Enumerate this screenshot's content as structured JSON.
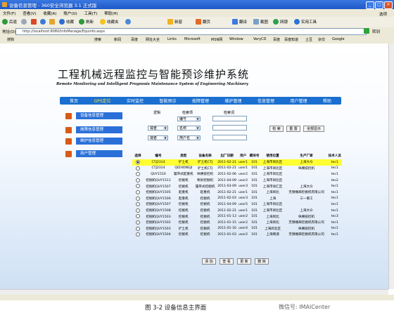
{
  "window": {
    "title": "设备信息管理 - 360安全浏览器 3.1 正式版"
  },
  "menu": {
    "items": [
      "文件(F)",
      "查看(V)",
      "收藏(A)",
      "账户(U)",
      "工具(T)",
      "帮助(H)"
    ],
    "right_label": "选项"
  },
  "toolbar": {
    "items": [
      "后退",
      "",
      "",
      "",
      "",
      "收藏",
      "刷新",
      "收藏夹",
      "",
      "新窗",
      "翻页",
      "翻译",
      "截图",
      "网银",
      "实用工具"
    ]
  },
  "address": {
    "label": "地址(D)",
    "url": "http://localhost:8080/InfoManage/Equinfo.aspx",
    "go_label": "转到"
  },
  "favorites": {
    "items": [
      "搜狗",
      "搜索",
      "新闻",
      "百度",
      "网址大全",
      "Links",
      "Microsoft",
      "MSN网",
      "Window",
      "VeryCD",
      "百度",
      "百度知道",
      "土豆",
      "杂交",
      "Google"
    ]
  },
  "header": {
    "title_cn": "工程机械远程监控与智能预诊维护系统",
    "title_en": "Remote Monitoring and Intelligent Prognosis Maintenance System of Engineering Machinery"
  },
  "nav": {
    "items": [
      "首页",
      "GPS定位",
      "实时监控",
      "智能预诊",
      "故障管理",
      "维护管理",
      "信息管理",
      "用户管理",
      "帮助"
    ]
  },
  "sidebar": {
    "items": [
      "设备信息管理",
      "故障信息管理",
      "维护信息管理",
      "用户管理"
    ]
  },
  "search": {
    "cond_label": "逻辑",
    "field_label": "检索项",
    "term_label": "检索词",
    "row1_field": "编号",
    "row2_logic": "或者",
    "row2_field": "名称",
    "row3_logic": "或者",
    "row3_field": "用户名",
    "btn_search": "检 索",
    "btn_reset": "重 置",
    "btn_all": "全部显示"
  },
  "table": {
    "headers": [
      "选择",
      "编号",
      "类型",
      "设备名称",
      "出厂日期",
      "用户",
      "模块号",
      "使用位置",
      "生产厂家",
      "技术人员"
    ],
    "selected_index": 0,
    "rows": [
      [
        "CTJ2314",
        "铲土机",
        "铲土机CTJ",
        "2011-02-21",
        "user1",
        "101",
        "上海市闵北区",
        "上海大众",
        "tec1"
      ],
      [
        "CTJ2314",
        "QIZHONGJI",
        "铲土机CTJ",
        "2011-02-21",
        "user1",
        "101",
        "上海市闵北区",
        "纵横技挖机",
        "tec1"
      ],
      [
        "QUY1510",
        "履带式起重机",
        "纵横技挖机",
        "2011-02-06",
        "user2",
        "101",
        "上海市闵北区",
        "",
        "tec1"
      ],
      [
        "挖掘机QUY1511",
        "挖掘机",
        "柴刹挖掘机",
        "2011-04-09",
        "user2",
        "101",
        "上海市闵北区",
        "",
        "tec2"
      ],
      [
        "挖掘机QUY1507",
        "挖掘机",
        "履带式挖掘机",
        "2011-03-09",
        "user3",
        "101",
        "上海市徐汇区",
        "上海大众",
        "tec1"
      ],
      [
        "挖掘机QUY1505",
        "起重机",
        "起重机",
        "2011-02-21",
        "user1",
        "101",
        "上海闵北",
        "无锡桶辞挖掘机有限公司",
        "tec1"
      ],
      [
        "挖掘机QUY1506",
        "起重机",
        "挖掘机",
        "2011-02-03",
        "user3",
        "101",
        "上海",
        "三一重工",
        "tec1"
      ],
      [
        "挖掘机QUY1507",
        "挖掘机",
        "挖掘机",
        "2011-04-09",
        "user5",
        "101",
        "上海市闵北区",
        "",
        "tec1"
      ],
      [
        "挖掘机QUY1508",
        "挖掘机",
        "挖掘机",
        "2011-02-21",
        "user1",
        "101",
        "上海市闵北区",
        "上海大众",
        "tec1"
      ],
      [
        "挖掘机QUY1503",
        "挖掘机",
        "挖掘机",
        "2011-01-13",
        "user2",
        "101",
        "上海闵北",
        "纵横技挖机",
        "tec3"
      ],
      [
        "挖掘机QUY1502",
        "挖掘机",
        "挖掘机",
        "2011-01-15",
        "user2",
        "101",
        "上海闵北",
        "无锡桶辞挖掘机有限公司",
        "tec1"
      ],
      [
        "挖掘机QUY1503",
        "铲土机",
        "挖掘机",
        "2011-01-16",
        "user4",
        "101",
        "上海闵北区",
        "纵横技挖机",
        "tec1"
      ],
      [
        "挖掘机QUY1504",
        "挖掘机",
        "挖掘机",
        "2011-01-03",
        "user2",
        "101",
        "上海杨浦",
        "无锡桶辞挖掘机有限公司",
        "tec1"
      ]
    ]
  },
  "actions": {
    "add": "添 加",
    "view": "查 看",
    "edit": "更 新",
    "delete": "删 除"
  },
  "caption": "图 3-2 设备信息主界面",
  "watermark": "微信号: IMAICenter",
  "colors": {
    "nav": "#1a6fd0",
    "sidebar_button": "#2a70d8",
    "sidebar_marker": "#d85a1a",
    "selected_row": "#ffff33"
  }
}
